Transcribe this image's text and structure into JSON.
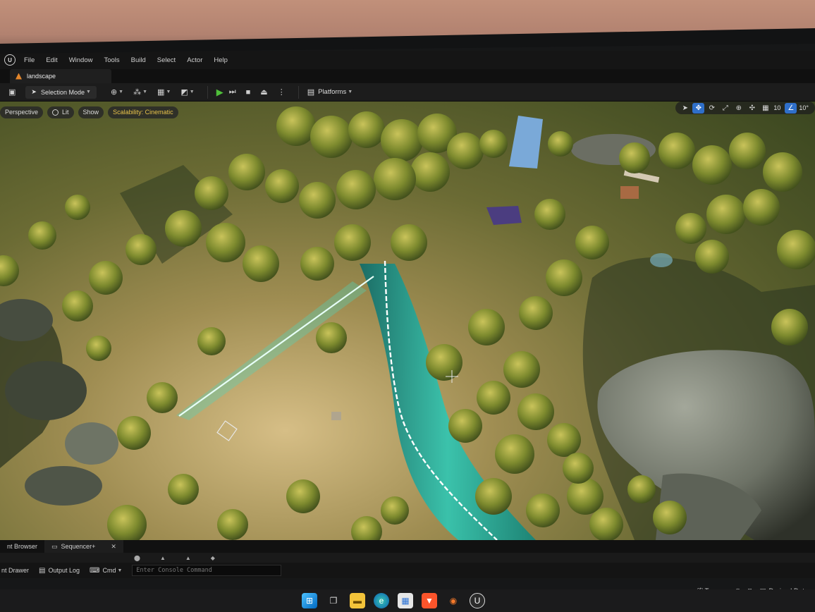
{
  "menu": {
    "items": [
      "File",
      "Edit",
      "Window",
      "Tools",
      "Build",
      "Select",
      "Actor",
      "Help"
    ]
  },
  "level_tab": {
    "label": "landscape"
  },
  "toolbar": {
    "selection_mode": "Selection Mode",
    "platforms": "Platforms"
  },
  "viewport": {
    "perspective": "Perspective",
    "lit": "Lit",
    "show": "Show",
    "scalability": "Scalability: Cinematic",
    "grid_snap": "10",
    "angle_snap": "10°"
  },
  "bottom": {
    "tab_content_browser": "nt Browser",
    "tab_sequencer": "Sequencer+",
    "content_drawer": "nt Drawer",
    "output_log": "Output Log",
    "cmd": "Cmd",
    "console_placeholder": "Enter Console Command",
    "trace": "Trace",
    "derived_data": "Derived Data"
  },
  "colors": {
    "accent_blue": "#2f6fc9",
    "play_green": "#4fbf3a",
    "scalability_yellow": "#e8c24a",
    "landscape_tab_icon": "#e4862b"
  },
  "taskbar": {
    "icons": [
      "windows-start-icon",
      "task-view-icon",
      "file-explorer-icon",
      "edge-browser-icon",
      "store-icon",
      "brave-browser-icon",
      "blender-icon",
      "unreal-engine-icon"
    ]
  }
}
